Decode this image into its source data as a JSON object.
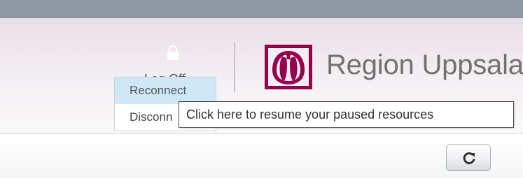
{
  "header": {
    "log_off_label": "Log Off",
    "logo_text": "Region Uppsala"
  },
  "menu": {
    "items": [
      {
        "label": "Reconnect",
        "state": "highlighted"
      },
      {
        "label": "Disconn"
      }
    ]
  },
  "tooltip": {
    "text": "Click here to resume your paused resources"
  },
  "icons": {
    "log_off": "lock-icon",
    "dropdown": "chevron-down-icon",
    "brand": "region-uppsala-logo-icon",
    "refresh": "refresh-icon"
  },
  "colors": {
    "top_strip": "#8f98a2",
    "header_top": "#e8dfe6",
    "brand_magenta": "#96004d",
    "menu_highlight": "#cfe8f7",
    "tooltip_border": "#4b4b4b"
  }
}
